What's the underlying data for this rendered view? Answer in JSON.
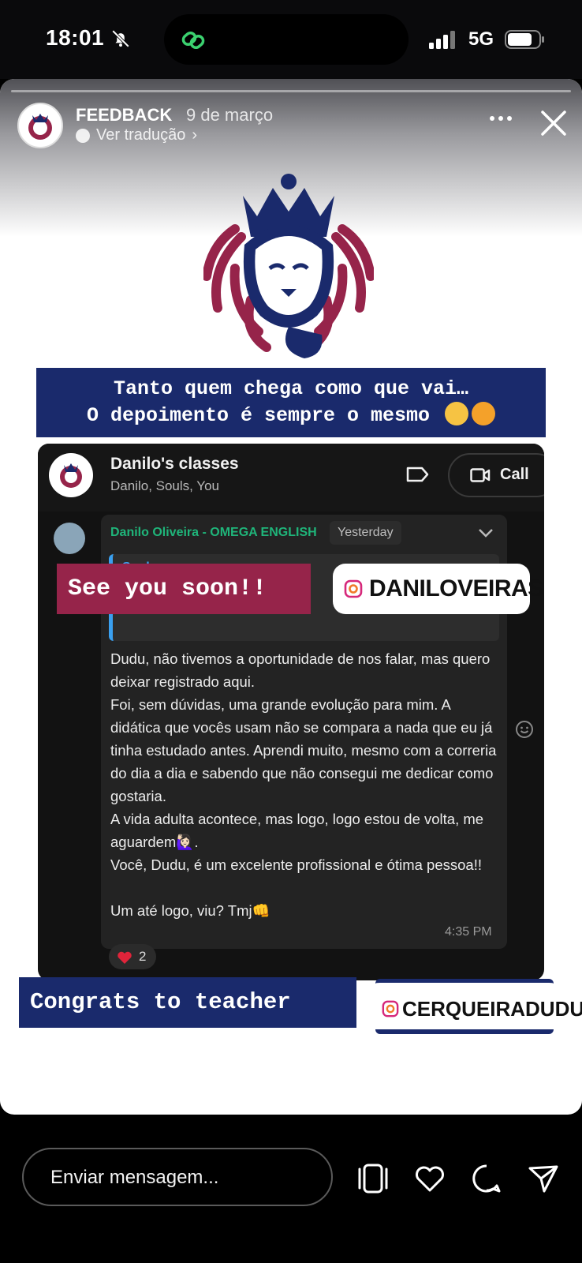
{
  "status_bar": {
    "time": "18:01",
    "network": "5G"
  },
  "story": {
    "username": "FEEDBACK",
    "date": "9 de março",
    "translate_label": "Ver tradução",
    "banner_line1": "Tanto quem chega como que vai…",
    "banner_line2": "O depoimento é sempre o mesmo",
    "sticker_text": "See you soon!!",
    "mention_top": "DANILOVEIRAS",
    "congrats_text": "Congrats to teacher",
    "mention_bottom": "CERQUEIRADUDU"
  },
  "chat": {
    "title": "Danilo's classes",
    "members": "Danilo, Souls, You",
    "call_label": "Call",
    "sender": "Danilo Oliveira - OMEGA ENGLISH",
    "date_chip": "Yesterday",
    "quote_name": "Souls",
    "message": "Dudu, não tivemos a oportunidade de nos falar, mas quero deixar registrado aqui.\nFoi, sem dúvidas, uma grande evolução para mim. A didática que vocês usam não se compara a nada que eu já tinha estudado antes. Aprendi muito, mesmo com a correria do dia a dia e sabendo que não consegui me dedicar como gostaria.\nA vida adulta acontece, mas logo, logo estou de volta, me aguardem🙋🏻‍♀️.\nVocê, Dudu, é um excelente profissional e ótima pessoa!!\n\nUm até logo, viu? Tmj👊",
    "time": "4:35 PM",
    "reaction_count": "2"
  },
  "bottom_bar": {
    "placeholder": "Enviar mensagem..."
  },
  "icons": [
    "bell-slash-icon",
    "link-icon",
    "signal-icon",
    "battery-icon",
    "more-icon",
    "close-icon",
    "label-icon",
    "video-icon",
    "chevron-down-icon",
    "heart-icon",
    "emoji-icon",
    "instagram-icon",
    "reels-icon",
    "like-icon",
    "comment-icon",
    "send-icon"
  ],
  "colors": {
    "navy": "#1a2a6c",
    "crimson": "#96244a",
    "whatsapp_green": "#1fb57a",
    "quote_blue": "#3aa0f0"
  }
}
